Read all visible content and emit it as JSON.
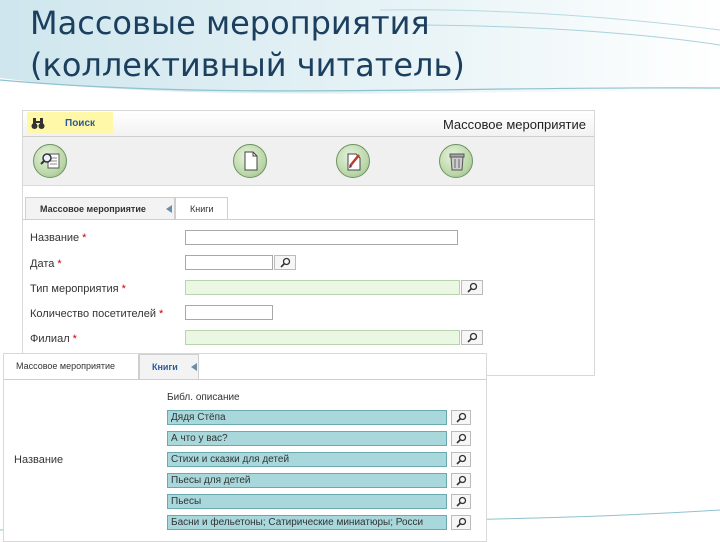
{
  "slide": {
    "title_line1": "Массовые мероприятия",
    "title_line2": "(коллективный читатель)"
  },
  "screen1": {
    "search_label": "Поиск",
    "module_title": "Массовое мероприятие",
    "toolbar": [
      "search-doc-icon",
      "new-doc-icon",
      "edit-doc-icon",
      "trash-icon"
    ],
    "tabs": [
      {
        "label": "Массовое мероприятие",
        "active": true
      },
      {
        "label": "Книги",
        "active": false
      }
    ],
    "form": {
      "name": {
        "label": "Название",
        "value": ""
      },
      "date": {
        "label": "Дата",
        "value": ""
      },
      "event_type": {
        "label": "Тип мероприятия",
        "value": ""
      },
      "visitors": {
        "label": "Количество посетителей",
        "value": ""
      },
      "branch": {
        "label": "Филиал",
        "value": ""
      },
      "required_mark": "*"
    }
  },
  "screen2": {
    "tabs": [
      {
        "label": "Массовое мероприятие",
        "active": false
      },
      {
        "label": "Книги",
        "active": true
      }
    ],
    "left_label": "Название",
    "column_header": "Библ. описание",
    "books": [
      "Дядя Стёпа",
      "А что у вас?",
      "Стихи и сказки для детей",
      "Пьесы для детей",
      "Пьесы",
      "Басни и фельетоны; Сатирические миниатюры; Росси"
    ]
  }
}
